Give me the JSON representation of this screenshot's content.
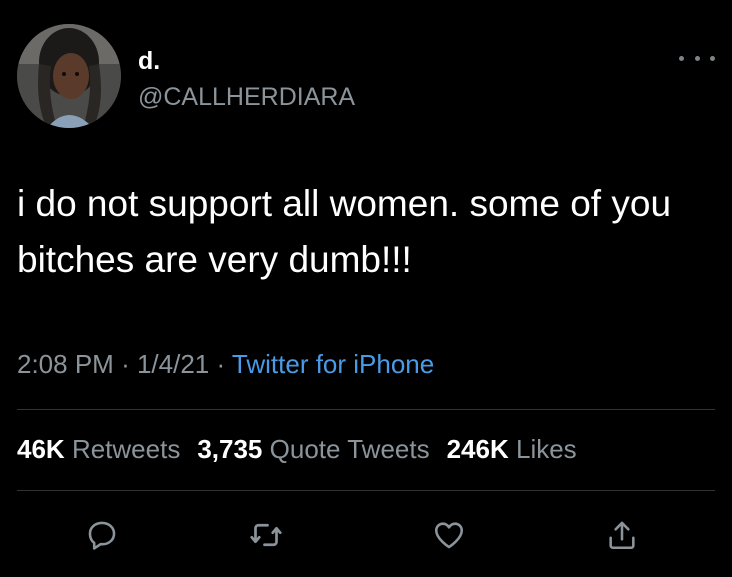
{
  "user": {
    "display_name": "d.",
    "handle": "@CALLHERDIARA"
  },
  "tweet": {
    "text": "i do not support all women. some of you bitches are very dumb!!!",
    "time": "2:08 PM",
    "date": "1/4/21",
    "source": "Twitter for iPhone"
  },
  "stats": {
    "retweets_count": "46K",
    "retweets_label": "Retweets",
    "quotes_count": "3,735",
    "quotes_label": "Quote Tweets",
    "likes_count": "246K",
    "likes_label": "Likes"
  },
  "icons": {
    "more": "more-dots-icon",
    "reply": "reply-icon",
    "retweet": "retweet-icon",
    "like": "heart-icon",
    "share": "share-icon"
  },
  "colors": {
    "background": "#000000",
    "text": "#ffffff",
    "secondary": "#8b949a",
    "link": "#4a9ae6",
    "divider": "#2f3336"
  }
}
